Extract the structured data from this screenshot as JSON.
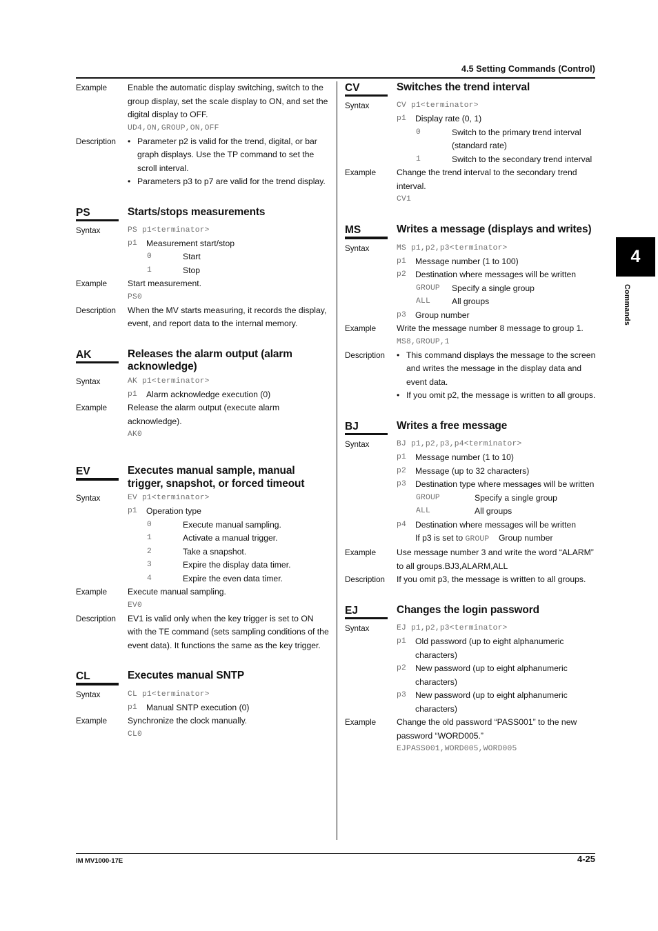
{
  "header": {
    "section_title": "4.5  Setting Commands (Control)"
  },
  "chapter_tab": {
    "number": "4",
    "label": "Commands"
  },
  "footer": {
    "manual_id": "IM MV1000-17E",
    "page_number": "4-25"
  },
  "labels": {
    "syntax": "Syntax",
    "example": "Example",
    "description": "Description",
    "bullet": "•"
  },
  "left_column": {
    "continued": {
      "example_label": "Example",
      "example_text": "Enable the automatic display switching, switch to the group display, set the scale display to ON, and set the digital display to OFF.",
      "example_code": "UD4,ON,GROUP,ON,OFF",
      "description_label": "Description",
      "description_bullets": [
        "Parameter p2 is valid for the trend, digital, or bar graph displays. Use the TP command to set the scroll interval.",
        "Parameters p3 to p7 are valid for the trend display."
      ]
    },
    "commands": [
      {
        "abbr": "PS",
        "title": "Starts/stops measurements",
        "syntax_code": "PS p1<terminator>",
        "params": [
          {
            "key": "p1",
            "desc": "Measurement start/stop"
          }
        ],
        "values": [
          {
            "key": "0",
            "desc": "Start"
          },
          {
            "key": "1",
            "desc": "Stop"
          }
        ],
        "example_text": "Start measurement.",
        "example_code": "PS0",
        "description_text": "When the MV starts measuring, it records the display, event, and report data to the internal memory."
      },
      {
        "abbr": "AK",
        "title": "Releases the alarm output (alarm acknowledge)",
        "syntax_code": "AK p1<terminator>",
        "params": [
          {
            "key": "p1",
            "desc": "Alarm acknowledge execution (0)"
          }
        ],
        "example_text": "Release the alarm output (execute alarm acknowledge).",
        "example_code": "AK0"
      },
      {
        "abbr": "EV",
        "title": "Executes manual sample, manual trigger, snapshot, or forced timeout",
        "syntax_code": "EV p1<terminator>",
        "params": [
          {
            "key": "p1",
            "desc": "Operation type"
          }
        ],
        "values": [
          {
            "key": "0",
            "desc": "Execute manual sampling."
          },
          {
            "key": "1",
            "desc": "Activate a manual trigger."
          },
          {
            "key": "2",
            "desc": "Take a snapshot."
          },
          {
            "key": "3",
            "desc": "Expire the display data timer."
          },
          {
            "key": "4",
            "desc": "Expire the even data timer."
          }
        ],
        "example_text": "Execute manual sampling.",
        "example_code": "EV0",
        "description_text": "EV1 is valid only when the key trigger is set to ON with the TE command (sets sampling conditions of the event data). It functions the same as the key trigger."
      },
      {
        "abbr": "CL",
        "title": "Executes manual SNTP",
        "syntax_code": "CL p1<terminator>",
        "params": [
          {
            "key": "p1",
            "desc": "Manual SNTP execution (0)"
          }
        ],
        "example_text": "Synchronize the clock manually.",
        "example_code": "CL0"
      }
    ]
  },
  "right_column": {
    "commands": [
      {
        "abbr": "CV",
        "title": "Switches the trend interval",
        "syntax_code": "CV p1<terminator>",
        "params": [
          {
            "key": "p1",
            "desc": "Display rate (0, 1)"
          }
        ],
        "values": [
          {
            "key": "0",
            "desc": "Switch to the primary trend interval (standard rate)"
          },
          {
            "key": "1",
            "desc": "Switch to the secondary trend interval"
          }
        ],
        "example_text": "Change the trend interval to the secondary trend interval.",
        "example_code": "CV1"
      },
      {
        "abbr": "MS",
        "title": "Writes a message (displays and writes)",
        "syntax_code": "MS p1,p2,p3<terminator>",
        "params": [
          {
            "key": "p1",
            "desc": "Message number (1 to 100)"
          },
          {
            "key": "p2",
            "desc": "Destination where messages will be written"
          }
        ],
        "values": [
          {
            "key": "GROUP",
            "desc": "Specify a single group"
          },
          {
            "key": "ALL",
            "desc": "All groups"
          }
        ],
        "params_after": [
          {
            "key": "p3",
            "desc": "Group number"
          }
        ],
        "example_text": "Write the message number 8 message to group 1.",
        "example_code": "MS8,GROUP,1",
        "description_bullets": [
          "This command displays the message to the screen and writes the message in the display data and event data.",
          "If you omit p2, the message is written to all groups."
        ]
      },
      {
        "abbr": "BJ",
        "title": "Writes a free message",
        "syntax_code": "BJ p1,p2,p3,p4<terminator>",
        "params": [
          {
            "key": "p1",
            "desc": "Message number (1 to 10)"
          },
          {
            "key": "p2",
            "desc": "Message (up to 32 characters)"
          },
          {
            "key": "p3",
            "desc": "Destination type where messages will be written"
          }
        ],
        "values": [
          {
            "key": "GROUP",
            "desc": "Specify a single group"
          },
          {
            "key": "ALL",
            "desc": "All groups"
          }
        ],
        "params_after": [
          {
            "key": "p4",
            "desc": "Destination where messages will be written"
          }
        ],
        "note_prefix": "If p3 is set to ",
        "note_code": "GROUP",
        "note_suffix": "Group number",
        "example_text": "Use message number 3 and write the word “ALARM” to all groups.BJ3,ALARM,ALL",
        "description_text": "If you omit p3, the message is written to all groups."
      },
      {
        "abbr": "EJ",
        "title": "Changes the login password",
        "syntax_code": "EJ p1,p2,p3<terminator>",
        "params": [
          {
            "key": "p1",
            "desc": "Old password (up to eight alphanumeric characters)"
          },
          {
            "key": "p2",
            "desc": "New password (up to eight alphanumeric characters)"
          },
          {
            "key": "p3",
            "desc": "New password (up to eight alphanumeric characters)"
          }
        ],
        "example_text": "Change the old password “PASS001” to the new password “WORD005.”",
        "example_code": "EJPASS001,WORD005,WORD005"
      }
    ]
  }
}
